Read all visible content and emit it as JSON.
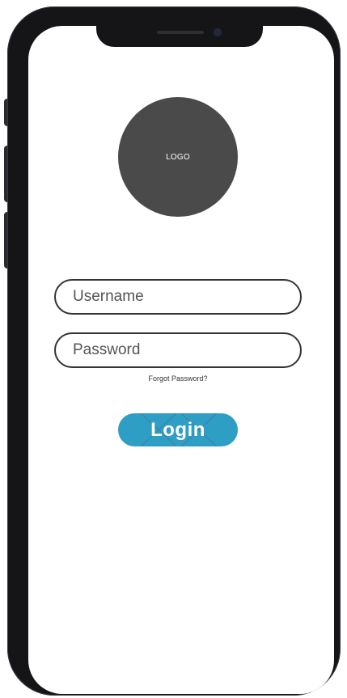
{
  "logo": {
    "label": "LOGO"
  },
  "form": {
    "username_placeholder": "Username",
    "password_placeholder": "Password",
    "forgot_label": "Forgot Password?",
    "login_label": "Login"
  },
  "colors": {
    "logo_fill": "#4a4a4a",
    "button_fill": "#2f9ec4",
    "field_border": "#333333",
    "device_frame": "#151518"
  },
  "icons": {
    "camera": "front-camera-icon",
    "speaker": "earpiece-speaker-icon"
  }
}
